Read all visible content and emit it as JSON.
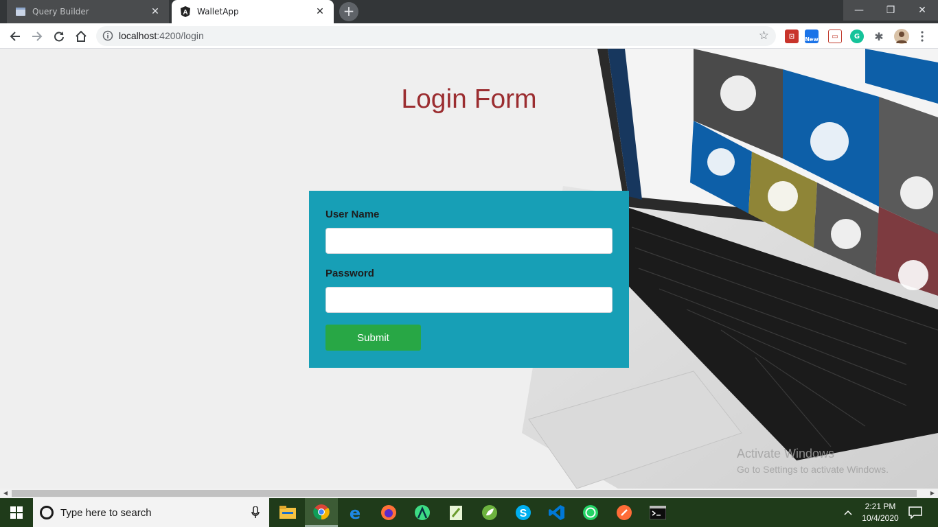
{
  "browser": {
    "tabs": [
      {
        "title": "Query Builder",
        "active": false,
        "icon": "query-builder-favicon"
      },
      {
        "title": "WalletApp",
        "active": true,
        "icon": "angular-favicon"
      }
    ],
    "new_tab_symbol": "+",
    "window_controls": {
      "minimize": "—",
      "maximize": "❐",
      "close": "✕"
    },
    "url_host": "localhost",
    "url_path": ":4200/login",
    "extensions": [
      "pdf-extension-icon",
      "new-extension-icon",
      "screenshot-extension-icon",
      "grammarly-icon",
      "puzzle-extensions-icon",
      "profile-avatar"
    ],
    "new_badge": "New",
    "grammarly_letter": "G"
  },
  "page": {
    "heading": "Login Form",
    "form": {
      "username_label": "User Name",
      "username_value": "",
      "password_label": "Password",
      "password_value": "",
      "submit_label": "Submit"
    },
    "watermark": {
      "line1": "Activate Windows",
      "line2": "Go to Settings to activate Windows."
    }
  },
  "taskbar": {
    "search_placeholder": "Type here to search",
    "apps": [
      "file-explorer-icon",
      "chrome-icon",
      "edge-icon",
      "firefox-icon",
      "android-studio-icon",
      "notepad-icon",
      "spring-tools-icon",
      "skype-icon",
      "vscode-icon",
      "whatsapp-icon",
      "postman-icon",
      "terminal-icon"
    ],
    "time": "2:21 PM",
    "date": "10/4/2020"
  },
  "colors": {
    "heading": "#9b2d30",
    "form_bg": "#179fb6",
    "submit_bg": "#28a745",
    "taskbar_bg": "#1f3b1a"
  }
}
